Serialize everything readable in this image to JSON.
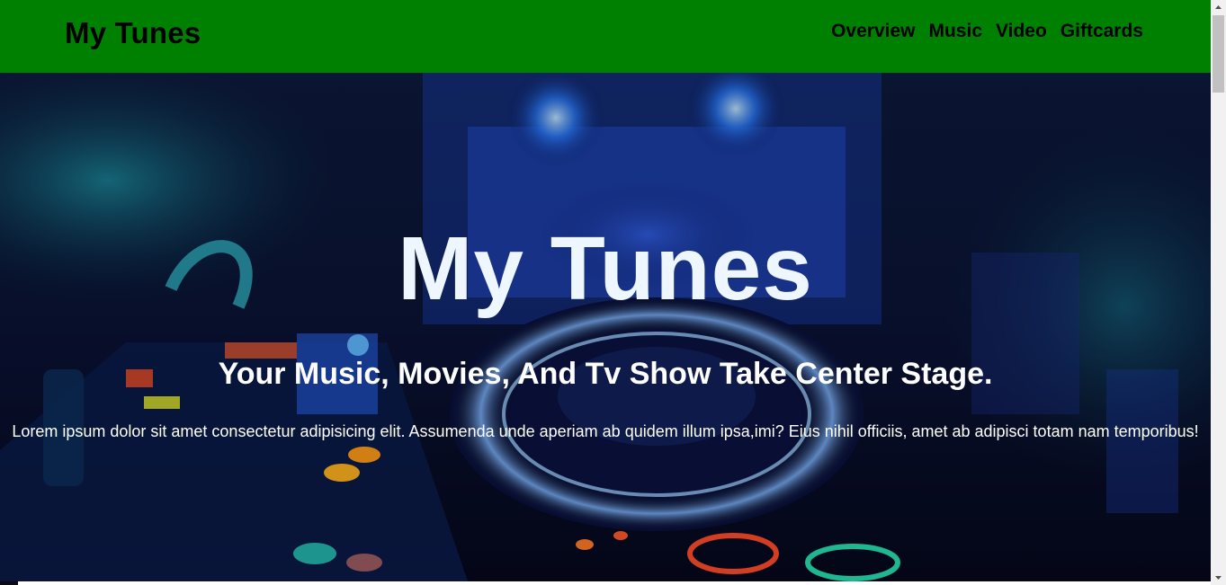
{
  "header": {
    "brand": "My Tunes",
    "nav": [
      {
        "label": "Overview"
      },
      {
        "label": "Music"
      },
      {
        "label": "Video"
      },
      {
        "label": "Giftcards"
      }
    ],
    "background_color": "#008000"
  },
  "hero": {
    "title": "My Tunes",
    "subtitle": "Your Music, Movies, And Tv Show Take Center Stage.",
    "text": "Lorem ipsum dolor sit amet consectetur adipisicing elit. Assumenda unde aperiam ab quidem illum ipsa,imi? Eius nihil officiis, amet ab adipisci totam nam temporibus!",
    "background_image": "dj-mixer-console"
  }
}
